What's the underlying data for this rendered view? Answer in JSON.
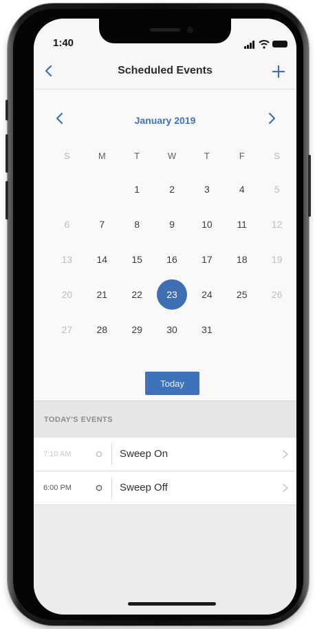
{
  "status_bar": {
    "time": "1:40"
  },
  "nav": {
    "title": "Scheduled Events"
  },
  "calendar": {
    "month_label": "January 2019",
    "weekday_headers": [
      "S",
      "M",
      "T",
      "W",
      "T",
      "F",
      "S"
    ],
    "weeks": [
      [
        "",
        "",
        "1",
        "2",
        "3",
        "4",
        "5"
      ],
      [
        "6",
        "7",
        "8",
        "9",
        "10",
        "11",
        "12"
      ],
      [
        "13",
        "14",
        "15",
        "16",
        "17",
        "18",
        "19"
      ],
      [
        "20",
        "21",
        "22",
        "23",
        "24",
        "25",
        "26"
      ],
      [
        "27",
        "28",
        "29",
        "30",
        "31",
        "",
        ""
      ]
    ],
    "selected_day": "23",
    "today_button_label": "Today"
  },
  "events": {
    "header": "TODAY'S EVENTS",
    "items": [
      {
        "time": "7:10 AM",
        "name": "Sweep On"
      },
      {
        "time": "6:00 PM",
        "name": "Sweep Off"
      }
    ]
  },
  "colors": {
    "accent": "#3e6fb3",
    "month_label": "#3f74b8",
    "weekend_text": "#bdbdbd"
  }
}
